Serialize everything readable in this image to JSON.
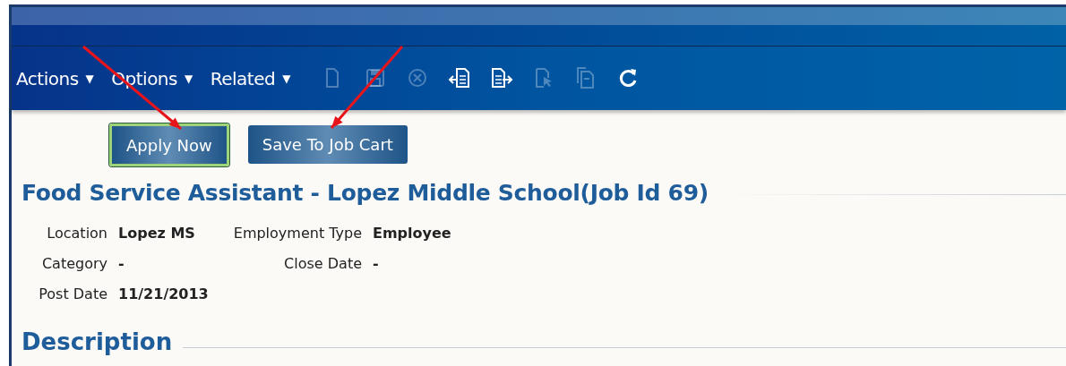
{
  "toolbar": {
    "menus": [
      {
        "label": "Actions",
        "icon": "▼"
      },
      {
        "label": "Options",
        "icon": "▼"
      },
      {
        "label": "Related",
        "icon": "▼"
      }
    ],
    "icons": [
      {
        "kind": "new",
        "disabled": true
      },
      {
        "kind": "save",
        "disabled": true
      },
      {
        "kind": "cancel",
        "disabled": true
      },
      {
        "kind": "import",
        "disabled": false
      },
      {
        "kind": "export",
        "disabled": false
      },
      {
        "kind": "select",
        "disabled": true
      },
      {
        "kind": "copy",
        "disabled": true
      },
      {
        "kind": "refresh",
        "disabled": false
      }
    ]
  },
  "buttons": [
    {
      "label": "Apply Now",
      "focused": true,
      "annotated": true
    },
    {
      "label": "Save To Job Cart",
      "focused": false,
      "annotated": true
    }
  ],
  "title": "Food Service Assistant - Lopez Middle School(Job Id 69)",
  "fields": [
    [
      {
        "label": "Location",
        "value": "Lopez MS"
      },
      {
        "label": "Employment Type",
        "value": "Employee"
      }
    ],
    [
      {
        "label": "Category",
        "value": "-"
      },
      {
        "label": "Close Date",
        "value": "-"
      }
    ],
    [
      {
        "label": "Post Date",
        "value": "11/21/2013"
      }
    ]
  ],
  "section_heading": "Description"
}
